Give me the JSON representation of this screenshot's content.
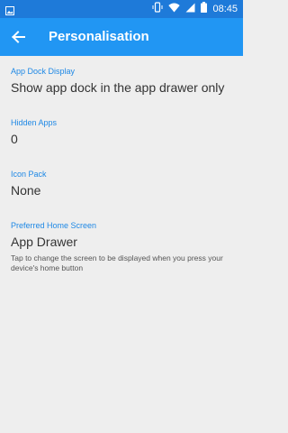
{
  "status_bar": {
    "time": "08:45",
    "left_icon": "gallery-notification-icon",
    "right_icons": [
      "vibrate-icon",
      "wifi-icon",
      "signal-icon",
      "battery-icon"
    ]
  },
  "app_bar": {
    "title": "Personalisation",
    "back_icon": "back-arrow-icon"
  },
  "preferences": [
    {
      "category": "App Dock Display",
      "value": "Show app dock in the app drawer only",
      "summary": ""
    },
    {
      "category": "Hidden Apps",
      "value": "0",
      "summary": ""
    },
    {
      "category": "Icon Pack",
      "value": "None",
      "summary": ""
    },
    {
      "category": "Preferred Home Screen",
      "value": "App Drawer",
      "summary": "Tap to change the screen to be displayed when you press your device's home button"
    }
  ],
  "colors": {
    "status_bar": "#1e7ad9",
    "app_bar": "#2196f3",
    "accent": "#1e88e5",
    "background": "#eeeeee"
  }
}
